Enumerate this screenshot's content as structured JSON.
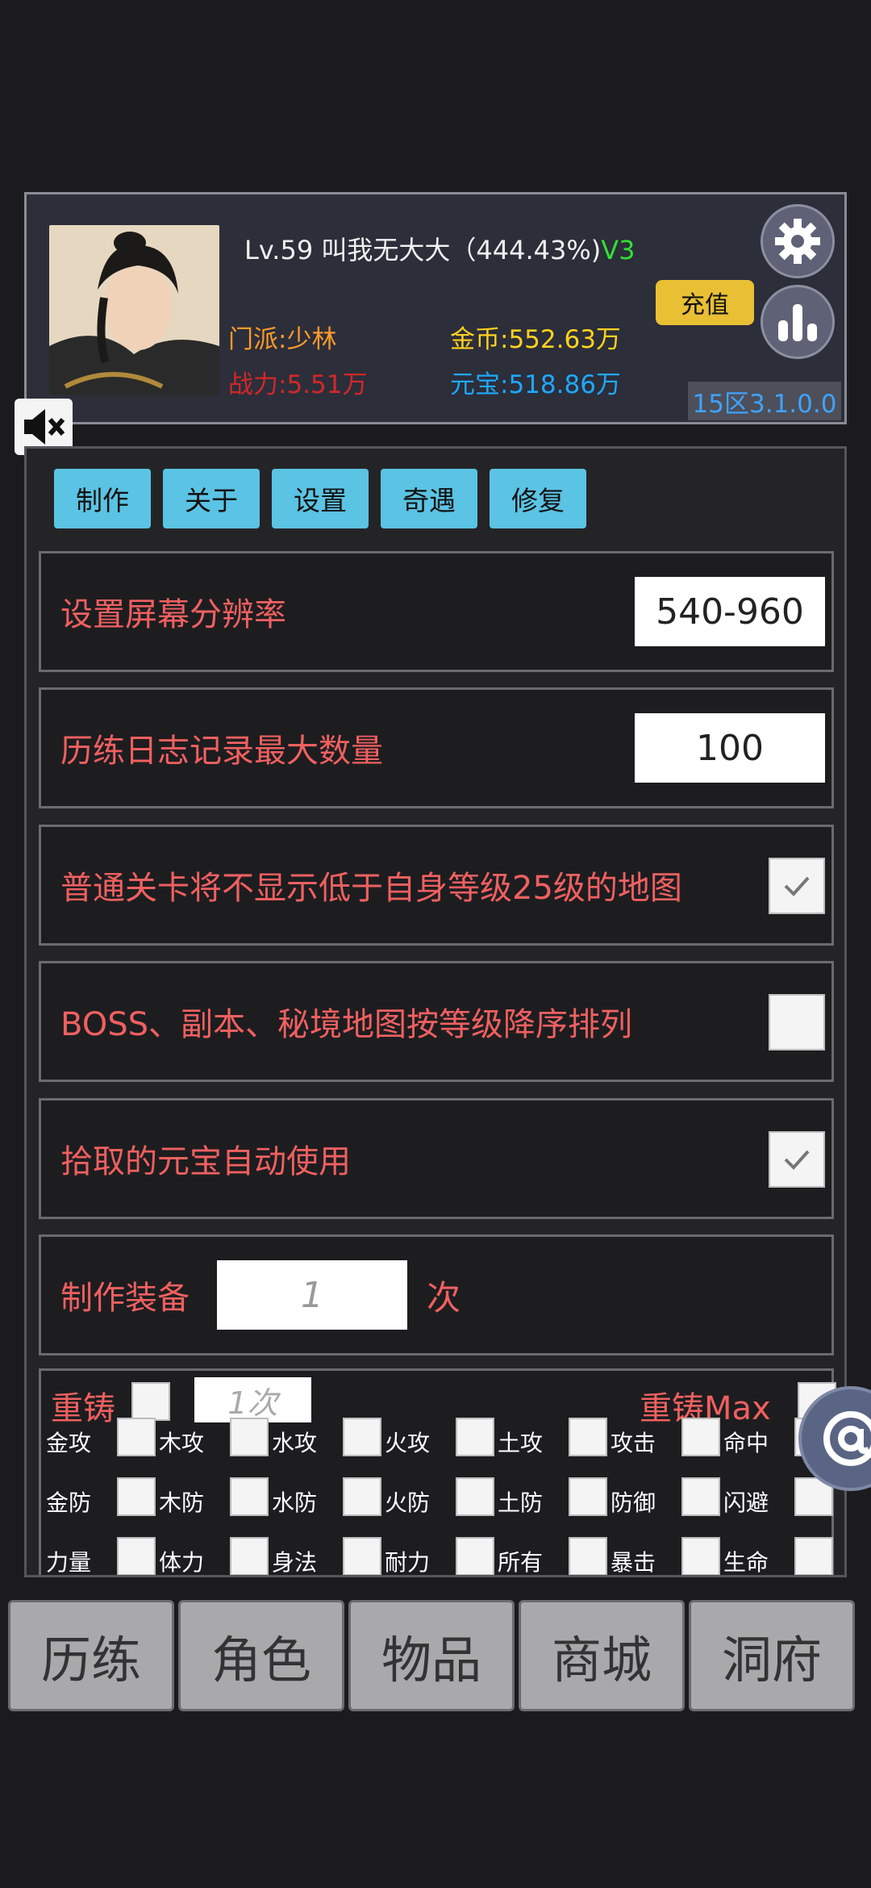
{
  "header": {
    "level": "Lv.59",
    "player_name": "叫我无大大",
    "exp_percent": "（444.43%)",
    "vip": "V3",
    "sect": "门派:少林",
    "power": "战力:5.51万",
    "gold": "金币:552.63万",
    "yuanbao": "元宝:518.86万",
    "recharge_label": "充值",
    "server": "15区3.1.0.0"
  },
  "tabs": [
    "制作",
    "关于",
    "设置",
    "奇遇",
    "修复"
  ],
  "settings": {
    "resolution_label": "设置屏幕分辨率",
    "resolution_value": "540-960",
    "log_max_label": "历练日志记录最大数量",
    "log_max_value": "100",
    "hide_low_maps_label": "普通关卡将不显示低于自身等级25级的地图",
    "hide_low_maps_checked": true,
    "boss_sort_label": "BOSS、副本、秘境地图按等级降序排列",
    "boss_sort_checked": false,
    "auto_use_yb_label": "拾取的元宝自动使用",
    "auto_use_yb_checked": true,
    "craft_label": "制作装备",
    "craft_times_placeholder": "1",
    "craft_unit": "次"
  },
  "recast": {
    "label": "重铸",
    "times_placeholder": "1次",
    "max_label": "重铸Max",
    "attrs_row1": [
      "金攻",
      "木攻",
      "水攻",
      "火攻",
      "土攻",
      "攻击",
      "命中"
    ],
    "attrs_row2": [
      "金防",
      "木防",
      "水防",
      "火防",
      "土防",
      "防御",
      "闪避"
    ],
    "attrs_row3": [
      "力量",
      "体力",
      "身法",
      "耐力",
      "所有",
      "暴击",
      "生命"
    ]
  },
  "nav": [
    "历练",
    "角色",
    "物品",
    "商城",
    "洞府"
  ],
  "colors": {
    "accent_tab": "#5bc3e3",
    "label_red": "#f06060",
    "gold": "#ffd21f",
    "yuanbao": "#1fa8ff",
    "vip_green": "#33e033"
  },
  "icons": {
    "settings": "gear-icon",
    "stats": "bar-chart-icon",
    "mute": "speaker-mute-icon",
    "floating": "at-sign-icon"
  }
}
